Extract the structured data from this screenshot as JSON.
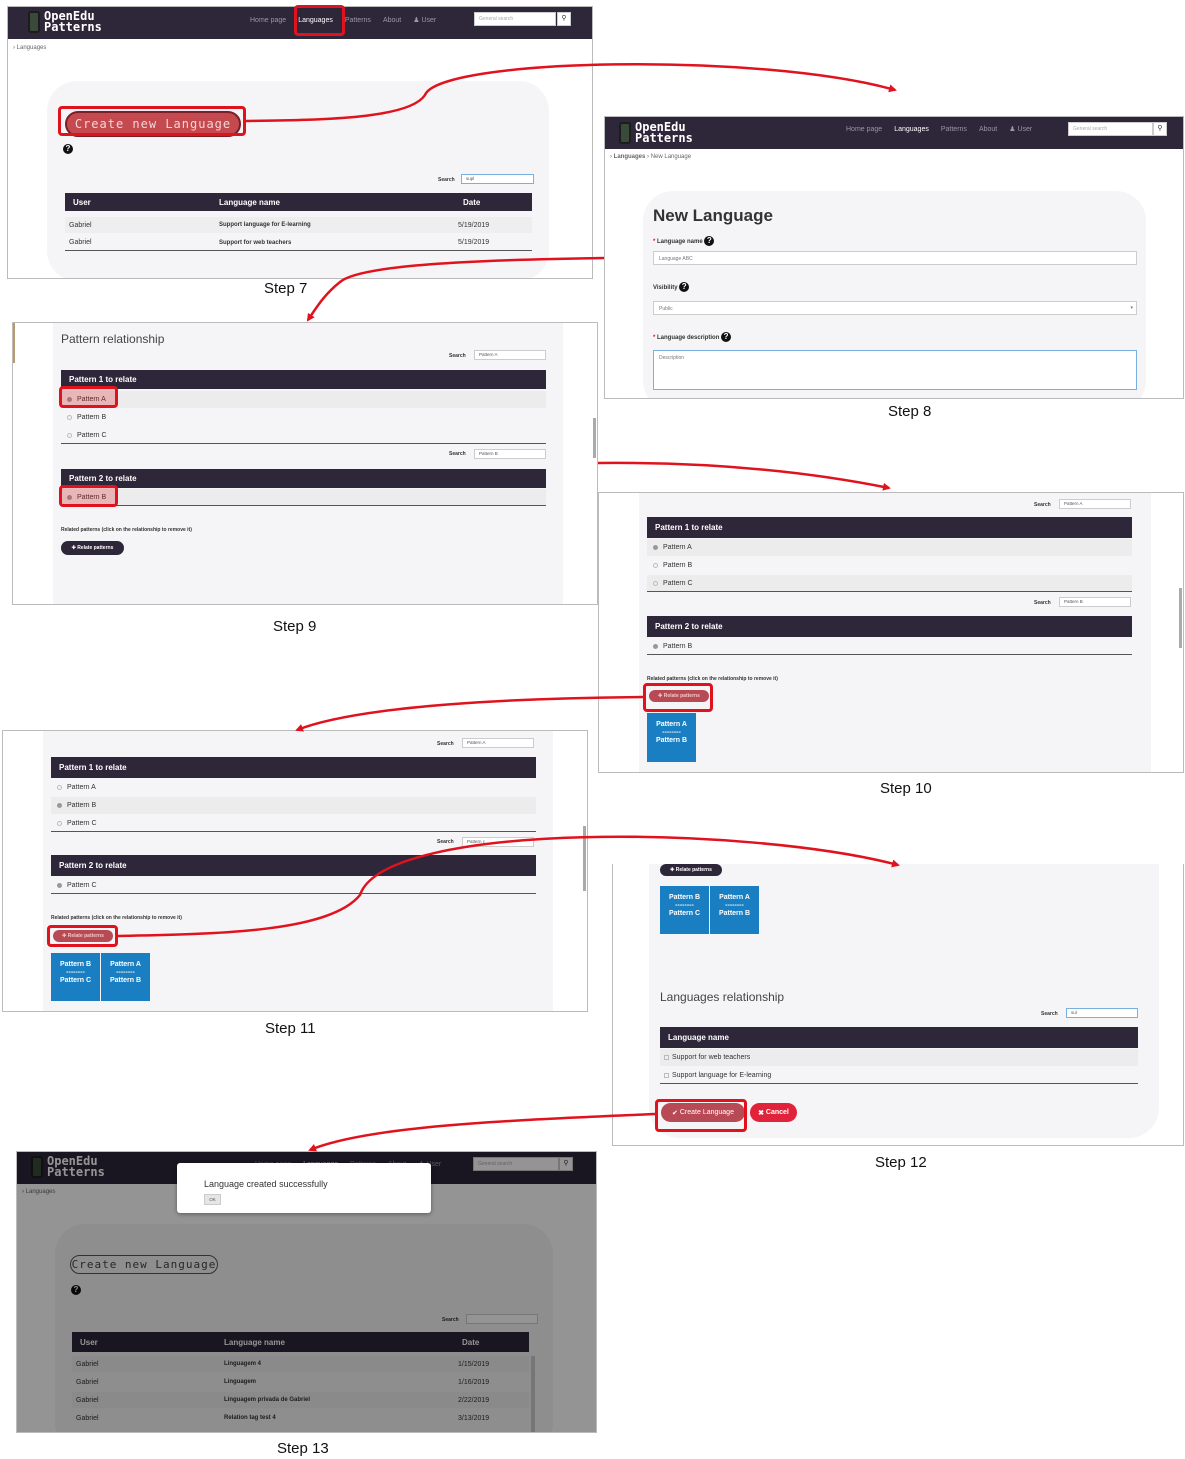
{
  "app": {
    "logo_line1": "OpenEdu",
    "logo_line2": "Patterns",
    "nav": [
      "Home page",
      "Languages",
      "Patterns",
      "About",
      "User"
    ],
    "general_search": "General search"
  },
  "step7": {
    "label": "Step 7",
    "crumb": "Languages",
    "create_button": "Create new Language",
    "search_label": "Search",
    "search_value": "supl",
    "columns": [
      "User",
      "Language name",
      "Date"
    ],
    "rows": [
      [
        "Gabriel",
        "Support language for E-learning",
        "5/19/2019"
      ],
      [
        "Gabriel",
        "Support for web teachers",
        "5/19/2019"
      ]
    ]
  },
  "step8": {
    "label": "Step 8",
    "crumb1": "Languages",
    "crumb2": "New Language",
    "title": "New Language",
    "name_label": "Language name",
    "name_value": "Language ABC",
    "visibility_label": "Visibility",
    "visibility_value": "Public",
    "desc_label": "Language description",
    "desc_placeholder": "Description"
  },
  "step9": {
    "label": "Step 9",
    "title": "Pattern relationship",
    "search_label": "Search",
    "search1": "Pattern A",
    "search2": "Pattern B",
    "header1": "Pattern 1 to relate",
    "header2": "Pattern 2 to relate",
    "list1": [
      "Pattern A",
      "Pattern B",
      "Pattern C"
    ],
    "list2": [
      "Pattern B"
    ],
    "related_label": "Related patterns (click on the relationship to remove it)",
    "relate_button": "Relate patterns"
  },
  "step10": {
    "label": "Step 10",
    "search_label": "Search",
    "search1": "Pattern A",
    "search2": "Pattern B",
    "header1": "Pattern 1 to relate",
    "header2": "Pattern 2 to relate",
    "list1": [
      "Pattern A",
      "Pattern B",
      "Pattern C"
    ],
    "list2": [
      "Pattern B"
    ],
    "related_label": "Related patterns (click on the relationship to remove it)",
    "relate_button": "Relate patterns",
    "rel": {
      "top": "Pattern A",
      "sep": "--------",
      "bottom": "Pattern B"
    }
  },
  "step11": {
    "label": "Step 11",
    "search_label": "Search",
    "search1": "Pattern A",
    "search2": "Pattern c",
    "header1": "Pattern 1 to relate",
    "header2": "Pattern 2 to relate",
    "list1": [
      "Pattern A",
      "Pattern B",
      "Pattern C"
    ],
    "list2": [
      "Pattern C"
    ],
    "related_label": "Related patterns (click on the relationship to remove it)",
    "relate_button": "Relate patterns",
    "rels": [
      {
        "top": "Pattern B",
        "sep": "--------",
        "bottom": "Pattern C"
      },
      {
        "top": "Pattern A",
        "sep": "--------",
        "bottom": "Pattern B"
      }
    ]
  },
  "step12": {
    "label": "Step 12",
    "relate_button": "Relate patterns",
    "rels": [
      {
        "top": "Pattern B",
        "sep": "--------",
        "bottom": "Pattern C"
      },
      {
        "top": "Pattern A",
        "sep": "--------",
        "bottom": "Pattern B"
      }
    ],
    "title": "Languages relationship",
    "search_label": "Search",
    "search_value": "sul",
    "column": "Language name",
    "rows": [
      "Support for web teachers",
      "Support language for E-learning"
    ],
    "create_button": "Create Language",
    "cancel_button": "Cancel"
  },
  "step13": {
    "label": "Step 13",
    "crumb": "Languages",
    "modal_text": "Language created successfully",
    "ok": "OK",
    "create_button": "Create new Language",
    "search_label": "Search",
    "columns": [
      "User",
      "Language name",
      "Date"
    ],
    "rows": [
      [
        "Gabriel",
        "Linguagem 4",
        "1/15/2019"
      ],
      [
        "Gabriel",
        "Linguagem",
        "1/16/2019"
      ],
      [
        "Gabriel",
        "Linguagem privada de Gabriel",
        "2/22/2019"
      ],
      [
        "Gabriel",
        "Relation tag test 4",
        "3/13/2019"
      ]
    ]
  },
  "colors": {
    "nav_bg": "#2e2639",
    "highlight": "#e0121d",
    "relation_blue": "#1a7fc2",
    "card_bg": "#f5f5f7"
  },
  "icons": [
    "question-circle-icon",
    "user-icon",
    "search-icon",
    "check-icon",
    "close-icon",
    "plus-icon",
    "chevron-right-icon"
  ]
}
